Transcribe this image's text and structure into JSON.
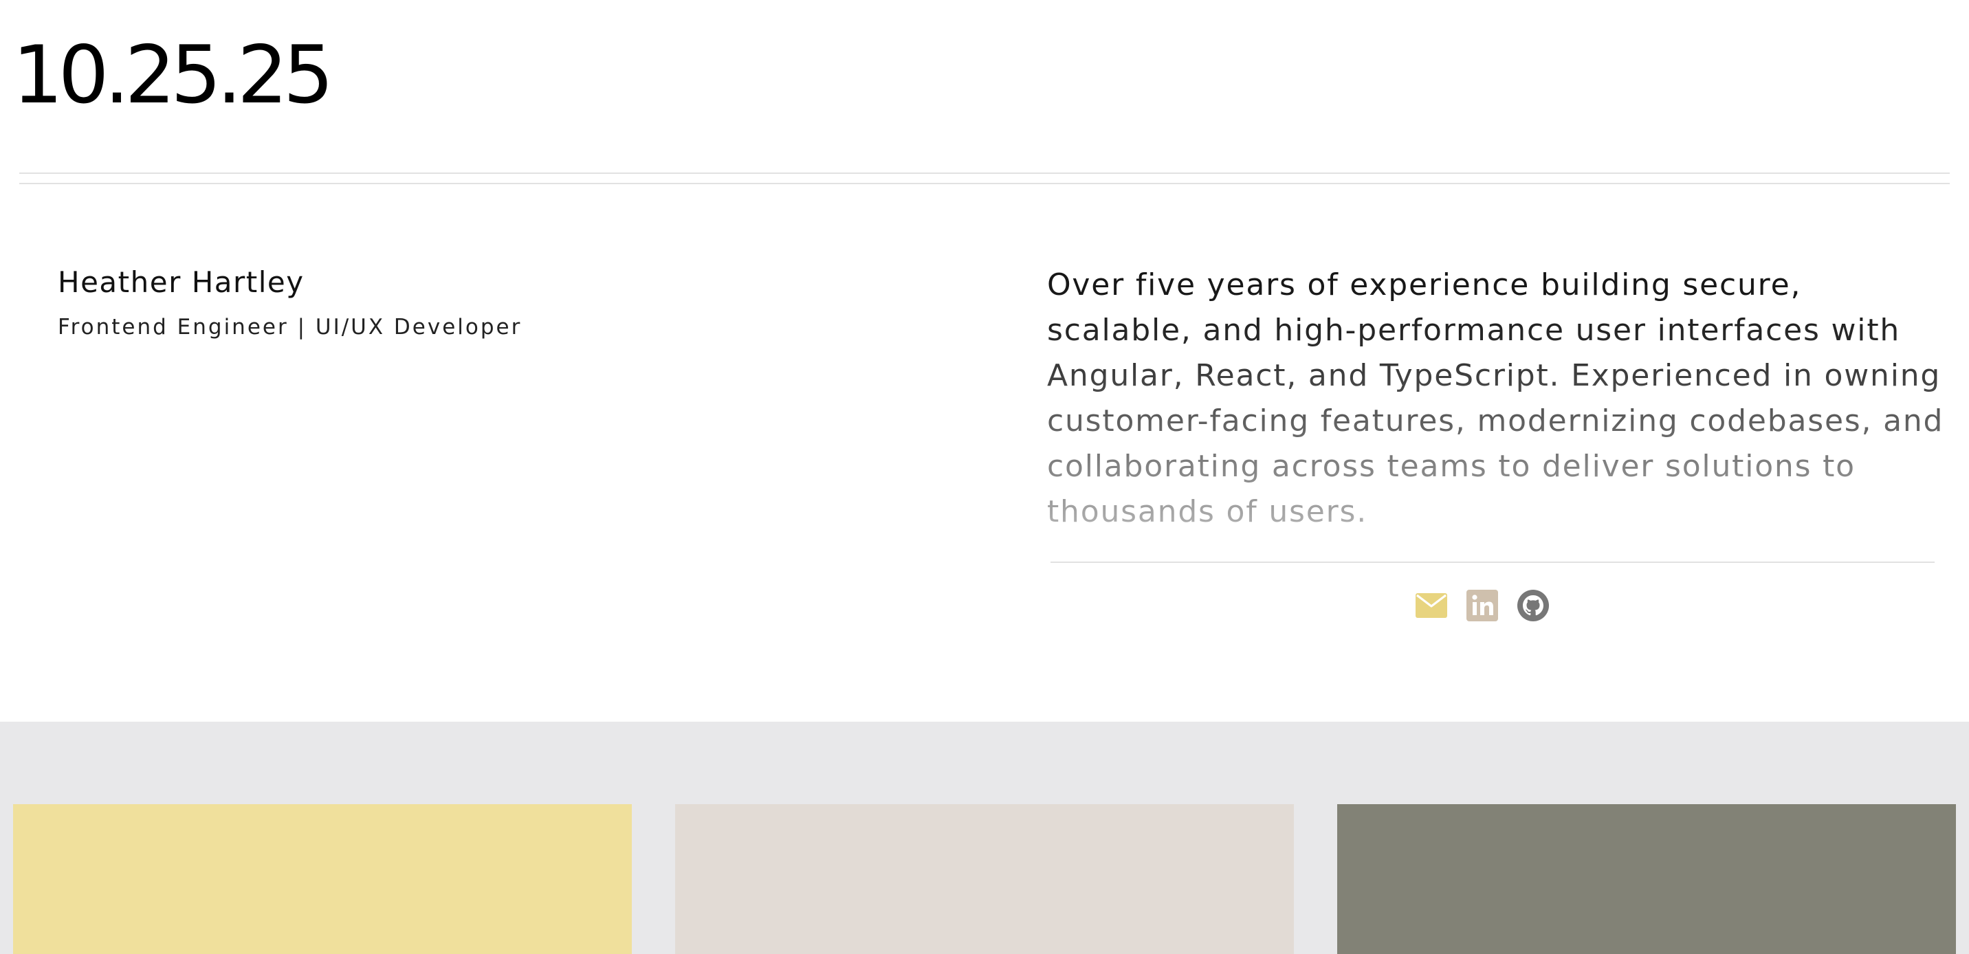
{
  "header": {
    "logo_text": "10.25.25"
  },
  "profile": {
    "name": "Heather Hartley",
    "role": "Frontend Engineer | UI/UX Developer"
  },
  "bio": {
    "text": "Over five years of experience building secure, scalable, and high-performance user interfaces with Angular, React, and TypeScript. Experienced in owning customer-facing features, modernizing codebases, and collaborating across teams to deliver solutions to thousands of users."
  },
  "social": {
    "links": [
      {
        "icon": "envelope-icon",
        "label": "Email",
        "color": "#e8d47f"
      },
      {
        "icon": "linkedin-icon",
        "label": "LinkedIn",
        "color": "#cfc0ad"
      },
      {
        "icon": "github-icon",
        "label": "GitHub",
        "color": "#777777"
      }
    ]
  },
  "cards": [
    {
      "color": "#f0e09c"
    },
    {
      "color": "#e2dbd5"
    },
    {
      "color": "#828276"
    }
  ],
  "colors": {
    "background": "#ffffff",
    "bottom_band": "#e8e8ea"
  }
}
